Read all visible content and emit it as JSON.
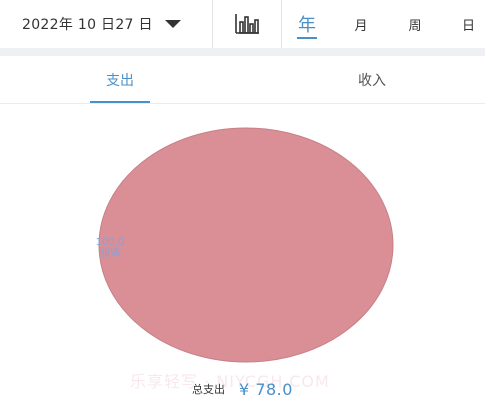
{
  "header": {
    "date_label": "2022年 10 日27 日",
    "periods": [
      "年",
      "月",
      "周",
      "日"
    ],
    "active_period": "年"
  },
  "tabs": {
    "expense_label": "支出",
    "income_label": "收入",
    "active": "支出"
  },
  "chart_data": {
    "type": "pie",
    "slices": [
      {
        "label": "服饰",
        "value": 100.0,
        "display_value": "100.0",
        "color": "#d98f95"
      }
    ]
  },
  "summary": {
    "total_label": "总支出",
    "total_value": "¥ 78.0"
  },
  "watermark": "乐享轻写 · NIYCGH.COM",
  "colors": {
    "accent": "#4a90c8",
    "slice": "#d98f95",
    "label": "#8aa0d8"
  }
}
